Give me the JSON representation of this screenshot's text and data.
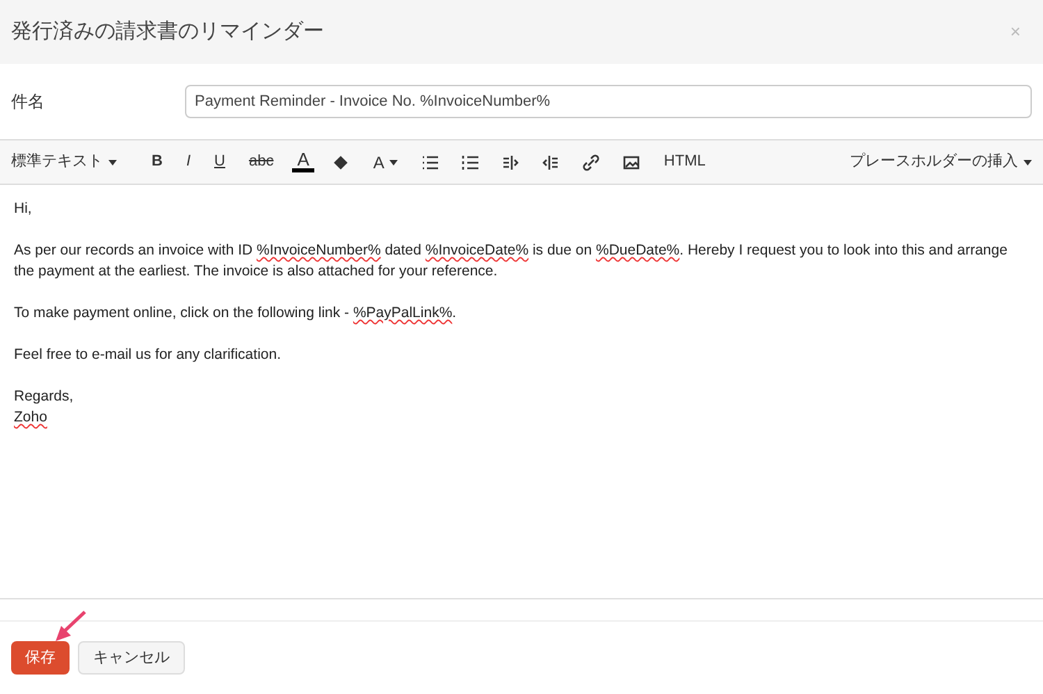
{
  "dialog": {
    "title": "発行済みの請求書のリマインダー",
    "close": "×"
  },
  "subject": {
    "label": "件名",
    "value": "Payment Reminder - Invoice No. %InvoiceNumber%"
  },
  "toolbar": {
    "format": "標準テキスト",
    "bold": "B",
    "italic": "I",
    "underline": "U",
    "strike": "abc",
    "font_color": "A",
    "font_size": "A",
    "html": "HTML",
    "placeholder": "プレースホルダーの挿入"
  },
  "body": [
    [
      {
        "text": "Hi,",
        "flagged": false
      }
    ],
    [
      {
        "text": "As per our records an invoice with ID ",
        "flagged": false
      },
      {
        "text": "%InvoiceNumber%",
        "flagged": true
      },
      {
        "text": " dated ",
        "flagged": false
      },
      {
        "text": "%InvoiceDate%",
        "flagged": true
      },
      {
        "text": " is due on ",
        "flagged": false
      },
      {
        "text": "%DueDate%",
        "flagged": true
      },
      {
        "text": ". Hereby I request you to look into this and arrange the payment at the earliest. The invoice is also attached for your reference.",
        "flagged": false
      }
    ],
    [
      {
        "text": "To make payment online, click on the following link - ",
        "flagged": false
      },
      {
        "text": "%PayPalLink%",
        "flagged": true
      },
      {
        "text": ".",
        "flagged": false
      }
    ],
    [
      {
        "text": "Feel free to e-mail us for any clarification.",
        "flagged": false
      }
    ],
    [
      {
        "text": "Regards,",
        "flagged": false
      }
    ],
    [
      {
        "text": "Zoho",
        "flagged": true
      }
    ]
  ],
  "buttons": [
    {
      "label": "保存",
      "kind": "primary"
    },
    {
      "label": "キャンセル",
      "kind": "secondary"
    }
  ]
}
